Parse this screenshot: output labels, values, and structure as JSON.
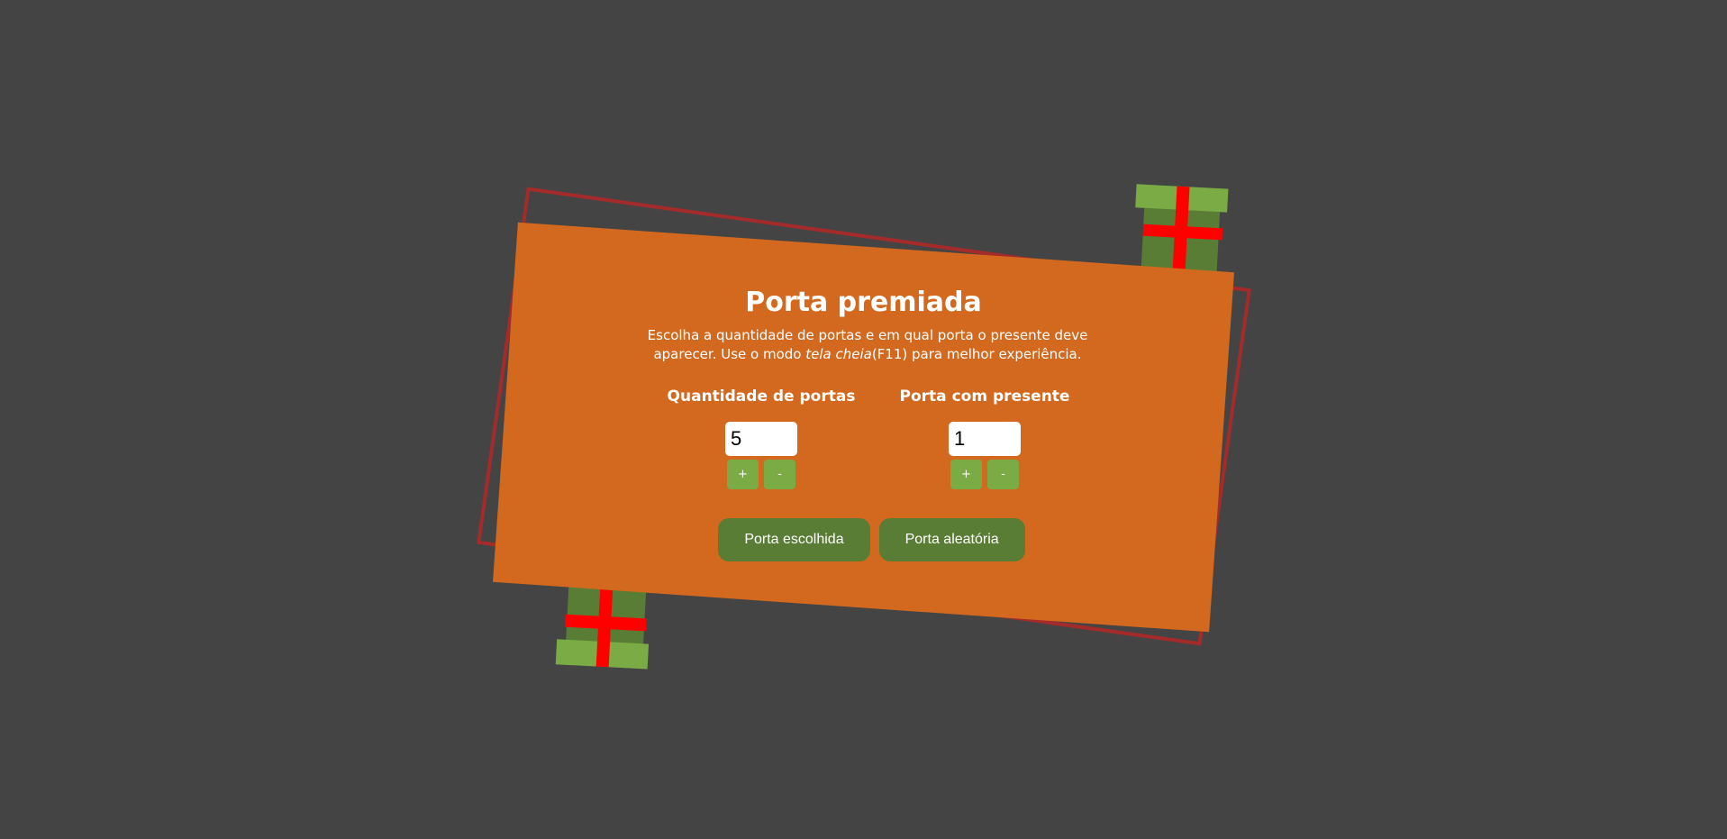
{
  "app": {
    "title": "Porta premiada",
    "description_part1": "Escolha a quantidade de portas e em qual porta o presente deve aparecer. Use o modo ",
    "description_emphasis": "tela cheia",
    "description_part2": "(F11) para melhor experiência."
  },
  "fields": {
    "doors": {
      "label": "Quantidade de portas",
      "value": "5",
      "plus_label": "+",
      "minus_label": "-"
    },
    "prize_door": {
      "label": "Porta com presente",
      "value": "1",
      "plus_label": "+",
      "minus_label": "-"
    }
  },
  "actions": {
    "chosen_door_label": "Porta escolhida",
    "random_door_label": "Porta aleatória"
  },
  "colors": {
    "background": "#444444",
    "card": "#d2691e",
    "outline": "#a52a2a",
    "button_dark_green": "#5a7d36",
    "button_light_green": "#7aab44",
    "ribbon": "#ff0000"
  },
  "icons": {
    "top_decoration": "gift-box-icon",
    "bottom_decoration": "gift-box-icon"
  }
}
